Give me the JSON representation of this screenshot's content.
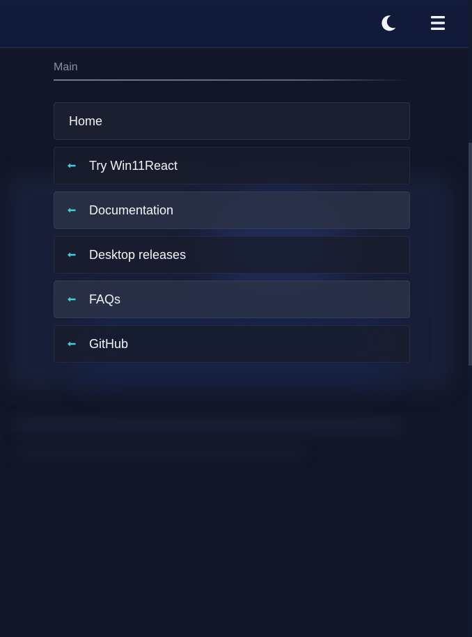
{
  "navbar": {
    "theme_toggle_icon": "moon-icon",
    "menu_icon": "hamburger-icon"
  },
  "sidebar": {
    "section_title": "Main",
    "items": [
      {
        "label": "Home",
        "icon": "",
        "active": true
      },
      {
        "label": "Try Win11React",
        "icon": "arrow-left-icon"
      },
      {
        "label": "Documentation",
        "icon": "arrow-left-icon"
      },
      {
        "label": "Desktop releases",
        "icon": "arrow-left-icon"
      },
      {
        "label": "FAQs",
        "icon": "arrow-left-icon"
      },
      {
        "label": "GitHub",
        "icon": "arrow-left-icon"
      }
    ]
  },
  "colors": {
    "background": "#121627",
    "navbar": "#121b3b",
    "accent": "#3fd0e0",
    "text": "#f2f4f8",
    "muted_text": "#8b90a0"
  }
}
